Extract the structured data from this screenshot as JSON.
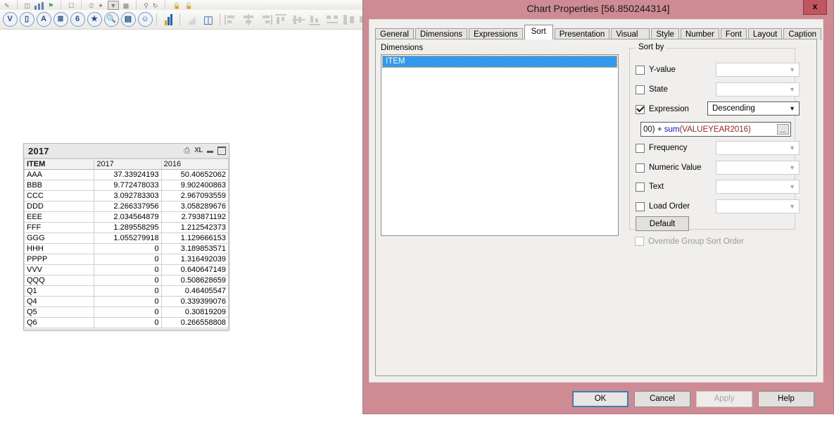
{
  "toolbar": {
    "top_row_icons": [
      "pencil-icon",
      "screen-icon",
      "bar-chart-icon",
      "flag-icon",
      "page-icon",
      "clock-icon",
      "wand-icon",
      "dropdown-icon",
      "text-icon"
    ],
    "main_row_icons": [
      {
        "name": "checkmark-list-icon",
        "glyph": "V"
      },
      {
        "name": "multibox-icon",
        "glyph": "▭"
      },
      {
        "name": "text-object-icon",
        "glyph": "A"
      },
      {
        "name": "list-object-icon",
        "glyph": "≣"
      },
      {
        "name": "current-selections-icon",
        "glyph": "6"
      },
      {
        "name": "bookmark-star-icon",
        "glyph": "★"
      },
      {
        "name": "search-object-icon",
        "glyph": "⚲"
      },
      {
        "name": "container-icon",
        "glyph": "▤"
      },
      {
        "name": "button-smiley-icon",
        "glyph": "☺"
      },
      {
        "name": "chart-wizard-icon",
        "glyph": "↗"
      },
      {
        "name": "format-painter-icon",
        "glyph": "◢"
      },
      {
        "name": "grid-snap-icon",
        "glyph": "▣"
      }
    ],
    "align_icons": [
      "align-left-icon",
      "align-center-horizontal-icon",
      "align-right-icon",
      "align-top-icon",
      "align-middle-icon",
      "align-bottom-icon",
      "distribute-horizontal-icon",
      "distribute-vertical-icon",
      "space-evenly-icon",
      "resize-same-icon"
    ]
  },
  "chart_object": {
    "caption_title": "2017",
    "caption_icons": [
      {
        "name": "print-icon",
        "glyph": "⎙"
      },
      {
        "name": "export-to-excel-icon",
        "glyph": "XL"
      },
      {
        "name": "minimize-icon",
        "glyph": "—"
      },
      {
        "name": "maximize-icon",
        "glyph": "□"
      }
    ],
    "columns": [
      "ITEM",
      "2017",
      "2016"
    ],
    "rows": [
      {
        "item": "AAA",
        "y2017": "37.33924193",
        "y2016": "50.40652062"
      },
      {
        "item": "BBB",
        "y2017": "9.772478033",
        "y2016": "9.902400863"
      },
      {
        "item": "CCC",
        "y2017": "3.092783303",
        "y2016": "2.967093559"
      },
      {
        "item": "DDD",
        "y2017": "2.266337956",
        "y2016": "3.058289676"
      },
      {
        "item": "EEE",
        "y2017": "2.034564879",
        "y2016": "2.793871192"
      },
      {
        "item": "FFF",
        "y2017": "1.289558295",
        "y2016": "1.212542373"
      },
      {
        "item": "GGG",
        "y2017": "1.055279918",
        "y2016": "1.129666153"
      },
      {
        "item": "HHH",
        "y2017": "0",
        "y2016": "3.189853571"
      },
      {
        "item": "PPPP",
        "y2017": "0",
        "y2016": "1.316492039"
      },
      {
        "item": "VVV",
        "y2017": "0",
        "y2016": "0.640647149"
      },
      {
        "item": "QQQ",
        "y2017": "0",
        "y2016": "0.508628659"
      },
      {
        "item": "Q1",
        "y2017": "0",
        "y2016": "0.46405547"
      },
      {
        "item": "Q4",
        "y2017": "0",
        "y2016": "0.339399076"
      },
      {
        "item": "Q5",
        "y2017": "0",
        "y2016": "0.30819209"
      },
      {
        "item": "Q6",
        "y2017": "0",
        "y2016": "0.266558808"
      }
    ]
  },
  "dialog": {
    "title": "Chart Properties [56.850244314]",
    "close_label": "x",
    "titlebar_color": "#cf8b94",
    "tabs": [
      {
        "label": "General",
        "active": false
      },
      {
        "label": "Dimensions",
        "active": false
      },
      {
        "label": "Expressions",
        "active": false
      },
      {
        "label": "Sort",
        "active": true
      },
      {
        "label": "Presentation",
        "active": false
      },
      {
        "label": "Visual Cues",
        "active": false
      },
      {
        "label": "Style",
        "active": false
      },
      {
        "label": "Number",
        "active": false
      },
      {
        "label": "Font",
        "active": false
      },
      {
        "label": "Layout",
        "active": false
      },
      {
        "label": "Caption",
        "active": false
      }
    ],
    "dimensions": {
      "label": "Dimensions",
      "items": [
        "ITEM"
      ],
      "selected": "ITEM"
    },
    "sort_by": {
      "group_label": "Sort by",
      "rows": [
        {
          "label": "Y-value",
          "checked": false,
          "value": "",
          "enabled": false
        },
        {
          "label": "State",
          "checked": false,
          "value": "",
          "enabled": false
        },
        {
          "label": "Expression",
          "checked": true,
          "value": "Descending",
          "enabled": true
        },
        {
          "label": "Frequency",
          "checked": false,
          "value": "",
          "enabled": false
        },
        {
          "label": "Numeric Value",
          "checked": false,
          "value": "",
          "enabled": false
        },
        {
          "label": "Text",
          "checked": false,
          "value": "",
          "enabled": false
        },
        {
          "label": "Load Order",
          "checked": false,
          "value": "",
          "enabled": false
        }
      ],
      "expression_field": {
        "prefix": "00) + ",
        "func": "sum",
        "arg": "(VALUEYEAR2016)",
        "ellipsis_label": "...",
        "func_color": "#1414d0",
        "arg_color": "#b02020"
      },
      "default_button": "Default"
    },
    "override_group_sort_order": {
      "label": "Override Group Sort Order",
      "checked": false,
      "enabled": false
    },
    "footer_buttons": [
      {
        "label": "OK",
        "state": "primary"
      },
      {
        "label": "Cancel",
        "state": "normal"
      },
      {
        "label": "Apply",
        "state": "disabled"
      },
      {
        "label": "Help",
        "state": "normal"
      }
    ]
  }
}
